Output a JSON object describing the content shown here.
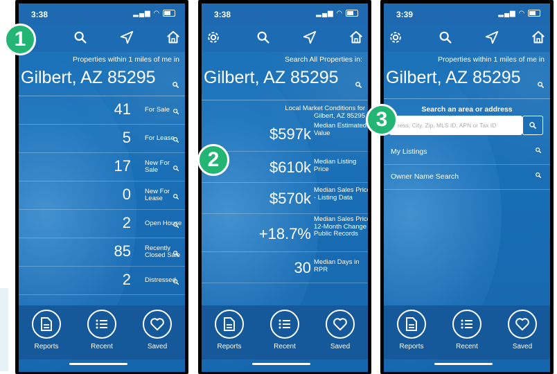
{
  "status": {
    "time1": "3:38",
    "time2": "3:38",
    "time3": "3:39"
  },
  "badges": {
    "one": "1",
    "two": "2",
    "three": "3"
  },
  "screen1": {
    "subtitle": "Properties within 1 miles of me in",
    "city": "Gilbert, AZ 85295",
    "rows": [
      {
        "num": "41",
        "label": "For Sale"
      },
      {
        "num": "5",
        "label": "For Lease"
      },
      {
        "num": "17",
        "label": "New For Sale"
      },
      {
        "num": "0",
        "label": "New For Lease"
      },
      {
        "num": "2",
        "label": "Open House"
      },
      {
        "num": "85",
        "label": "Recently Closed Sale"
      },
      {
        "num": "2",
        "label": "Distressed"
      }
    ]
  },
  "screen2": {
    "subtitle": "Search All Properties in:",
    "city": "Gilbert, AZ 85295",
    "market_title": "Local Market Conditions for Gilbert, AZ 85295",
    "metrics": [
      {
        "value": "$597k",
        "label": "Median Estimated Value"
      },
      {
        "value": "$610k",
        "label": "Median Listing Price"
      },
      {
        "value": "$570k",
        "label": "Median Sales Price - Listing Data"
      },
      {
        "value": "+18.7%",
        "label": "Median Sales Price 12-Month Change - Public Records"
      },
      {
        "value": "30",
        "label": "Median Days in RPR"
      }
    ]
  },
  "screen3": {
    "subtitle": "Properties within 1 miles of me in",
    "city": "Gilbert, AZ 85295",
    "search_heading": "Search an area or address",
    "search_placeholder": "ress, City, Zip, MLS ID, APN or Tax ID",
    "links": [
      "My Listings",
      "Owner Name Search"
    ]
  },
  "tabs": {
    "reports": "Reports",
    "recent": "Recent",
    "saved": "Saved"
  },
  "colors": {
    "screen_blue": "#1a6fb6",
    "badge_green": "#22b573"
  }
}
